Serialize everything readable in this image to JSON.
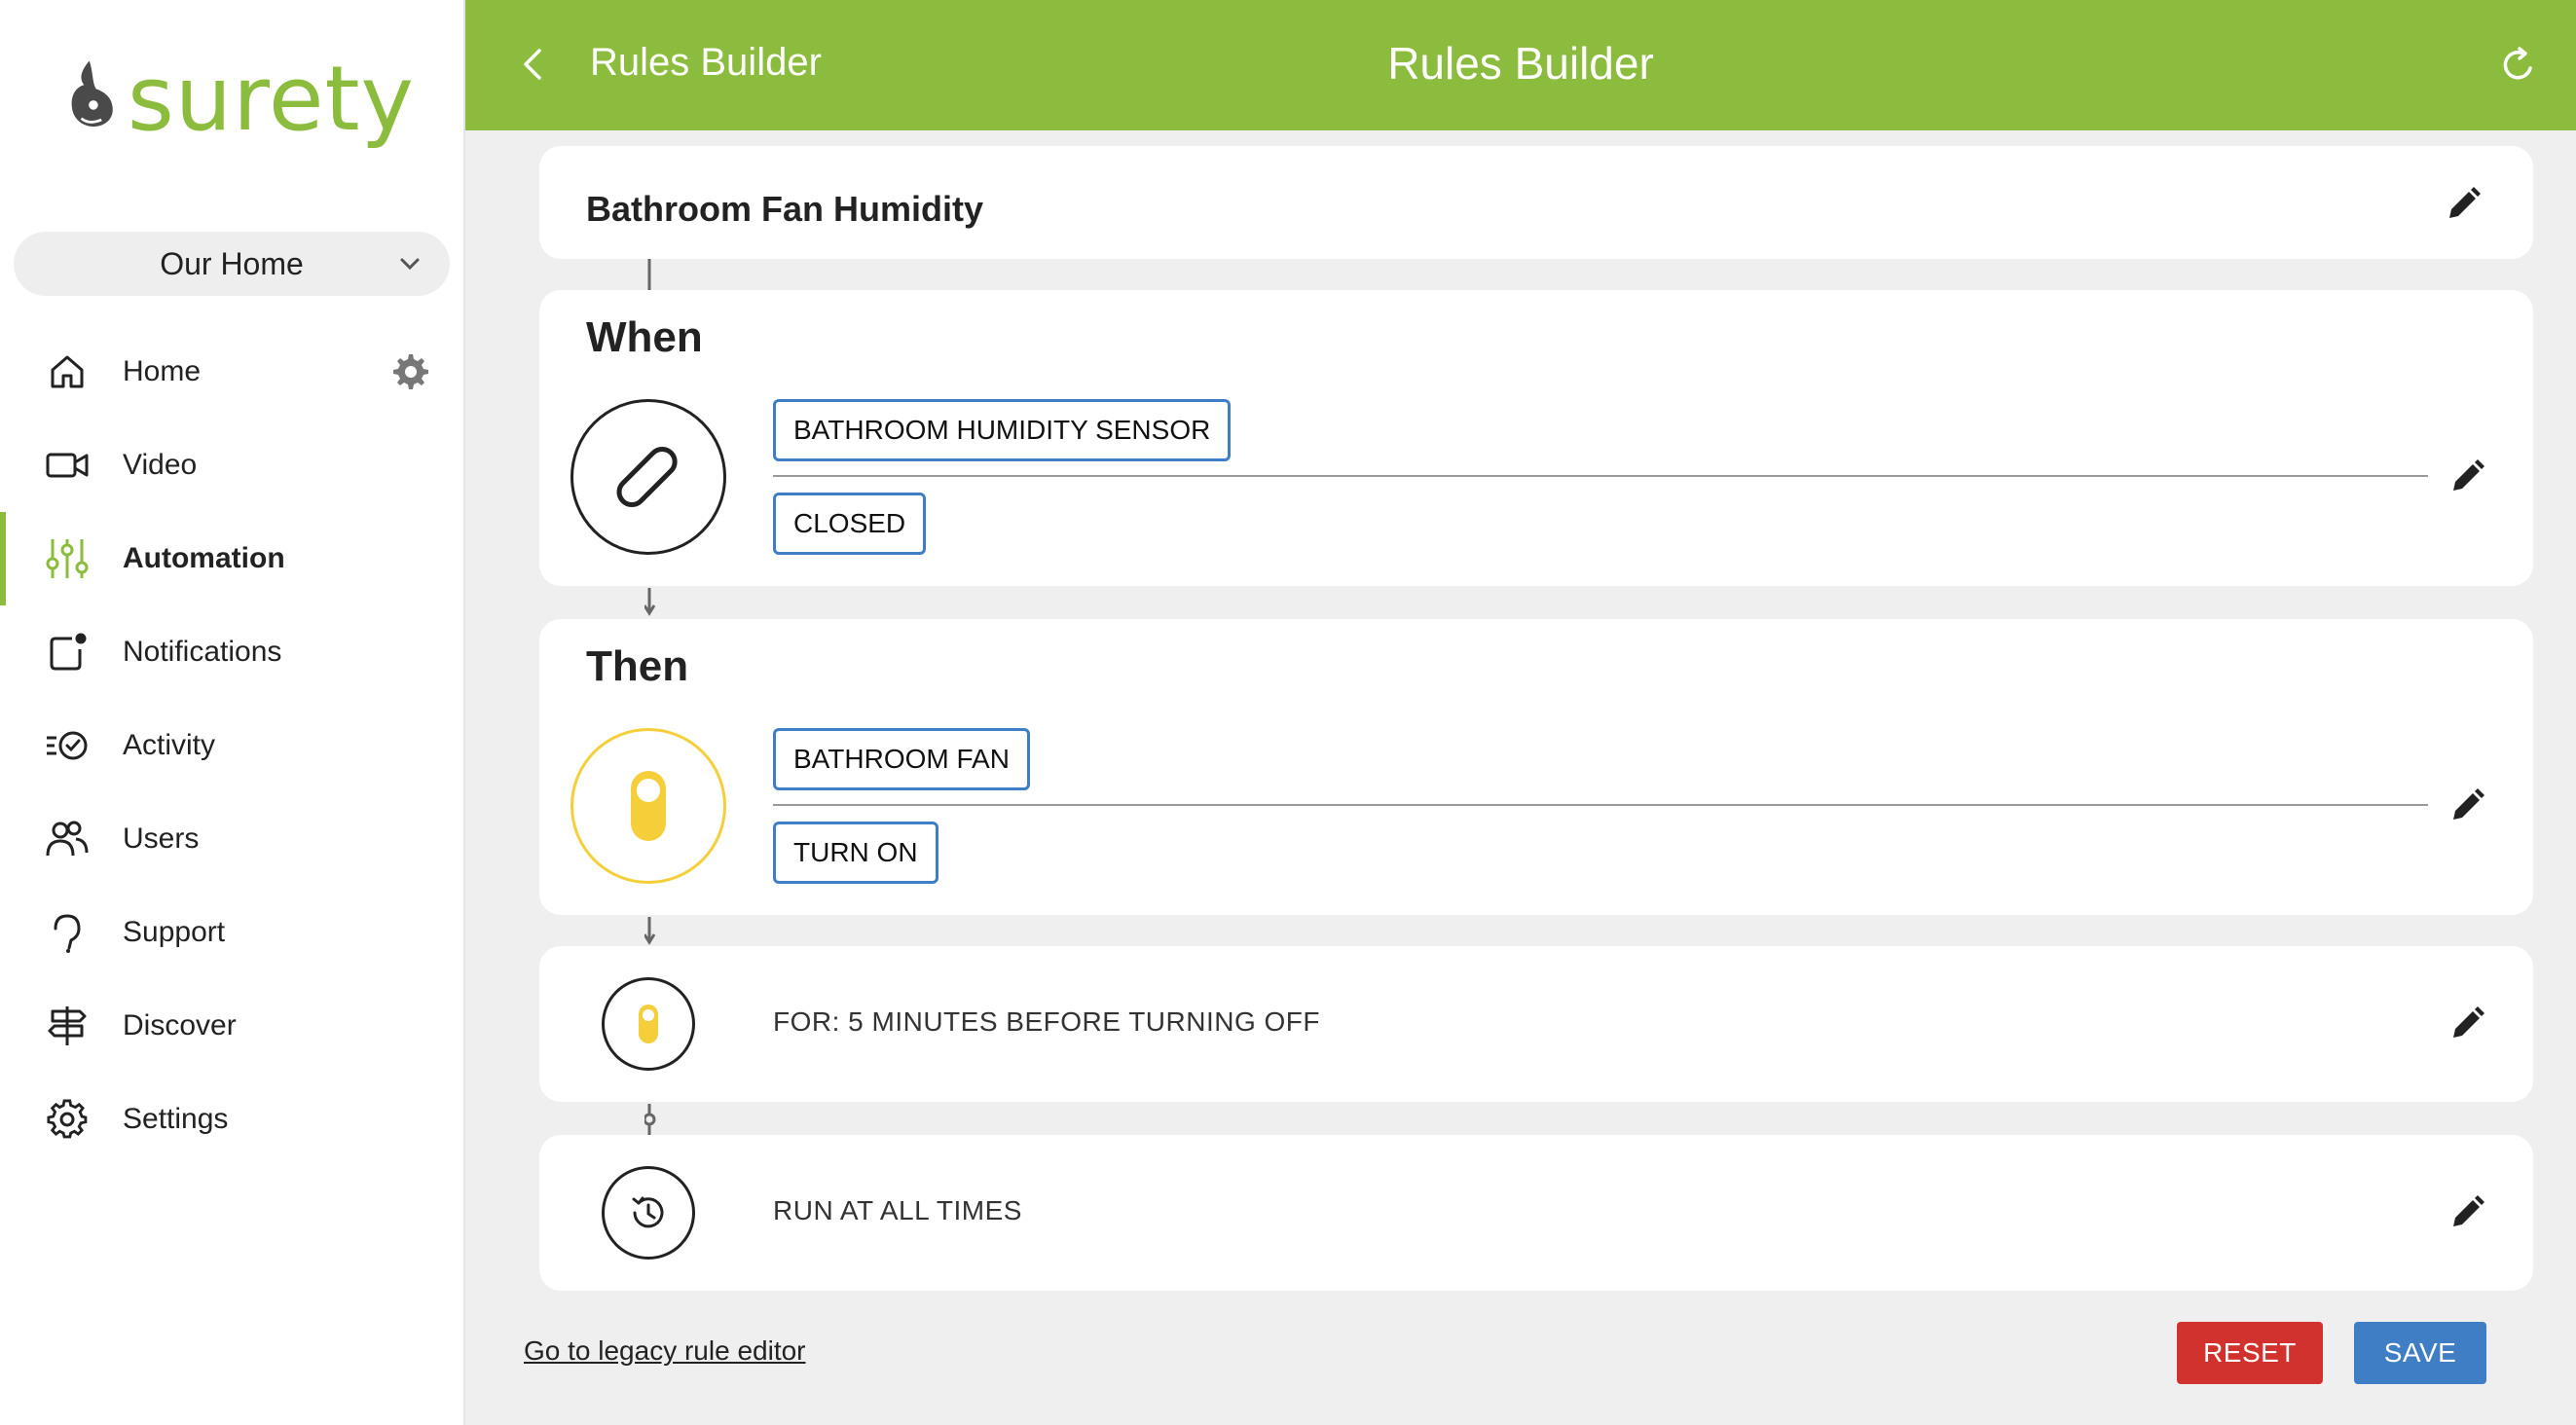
{
  "brand": {
    "name": "surety",
    "color": "#8cbc3e"
  },
  "sidebar": {
    "location": "Our Home",
    "items": [
      {
        "label": "Home",
        "icon": "home-icon"
      },
      {
        "label": "Video",
        "icon": "video-icon"
      },
      {
        "label": "Automation",
        "icon": "sliders-icon",
        "active": true
      },
      {
        "label": "Notifications",
        "icon": "notification-icon"
      },
      {
        "label": "Activity",
        "icon": "activity-icon"
      },
      {
        "label": "Users",
        "icon": "users-icon"
      },
      {
        "label": "Support",
        "icon": "support-icon"
      },
      {
        "label": "Discover",
        "icon": "signpost-icon"
      },
      {
        "label": "Settings",
        "icon": "gear-icon"
      }
    ]
  },
  "header": {
    "back_label": "Rules Builder",
    "title": "Rules Builder"
  },
  "rule": {
    "name": "Bathroom Fan Humidity",
    "when": {
      "title": "When",
      "device": "BATHROOM HUMIDITY SENSOR",
      "state": "CLOSED"
    },
    "then": {
      "title": "Then",
      "device": "BATHROOM FAN",
      "action": "TURN ON"
    },
    "duration": "FOR: 5 MINUTES BEFORE TURNING OFF",
    "schedule": "RUN AT ALL TIMES"
  },
  "footer": {
    "legacy_link": "Go to legacy rule editor",
    "reset_label": "RESET",
    "save_label": "SAVE"
  },
  "colors": {
    "accent": "#8cbc3e",
    "chip_border": "#3f7ec5",
    "reset": "#d2322d",
    "save": "#3f7ec5",
    "switch_yellow": "#f5cf3a"
  }
}
